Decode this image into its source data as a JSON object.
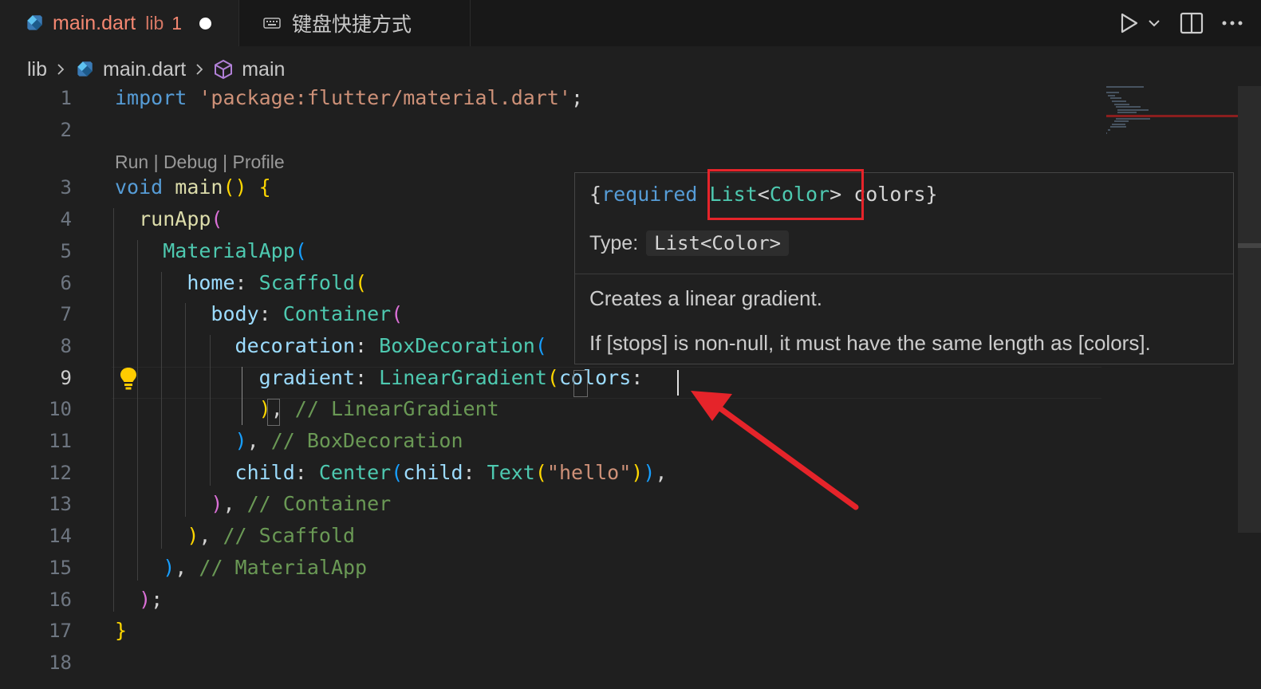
{
  "tabs": [
    {
      "name": "main.dart",
      "dir": "lib",
      "errors": "1",
      "dirty": true,
      "active": true
    },
    {
      "name": "键盘快捷方式",
      "active": false
    }
  ],
  "breadcrumb": {
    "folder": "lib",
    "file": "main.dart",
    "symbol": "main"
  },
  "editor": {
    "codelens": "Run | Debug | Profile",
    "current_line": 9,
    "lines": [
      {
        "num": "1",
        "tokens": [
          [
            "k",
            "import"
          ],
          [
            "pun",
            " "
          ],
          [
            "s",
            "'package:flutter/material.dart'"
          ],
          [
            "pun",
            ";"
          ]
        ]
      },
      {
        "num": "2",
        "tokens": []
      },
      {
        "num": "3",
        "tokens": [
          [
            "k",
            "void"
          ],
          [
            "pun",
            " "
          ],
          [
            "f",
            "main"
          ],
          [
            "b1",
            "()"
          ],
          [
            "pun",
            " "
          ],
          [
            "b1",
            "{"
          ]
        ]
      },
      {
        "num": "4",
        "tokens": [
          [
            "pun",
            "  "
          ],
          [
            "f",
            "runApp"
          ],
          [
            "b2",
            "("
          ]
        ]
      },
      {
        "num": "5",
        "tokens": [
          [
            "pun",
            "    "
          ],
          [
            "t",
            "MaterialApp"
          ],
          [
            "b3",
            "("
          ]
        ]
      },
      {
        "num": "6",
        "tokens": [
          [
            "pun",
            "      "
          ],
          [
            "p",
            "home"
          ],
          [
            "pun",
            ": "
          ],
          [
            "t",
            "Scaffold"
          ],
          [
            "b1",
            "("
          ]
        ]
      },
      {
        "num": "7",
        "tokens": [
          [
            "pun",
            "        "
          ],
          [
            "p",
            "body"
          ],
          [
            "pun",
            ": "
          ],
          [
            "t",
            "Container"
          ],
          [
            "b2",
            "("
          ]
        ]
      },
      {
        "num": "8",
        "tokens": [
          [
            "pun",
            "          "
          ],
          [
            "p",
            "decoration"
          ],
          [
            "pun",
            ": "
          ],
          [
            "t",
            "BoxDecoration"
          ],
          [
            "b3",
            "("
          ]
        ]
      },
      {
        "num": "9",
        "tokens": [
          [
            "pun",
            "            "
          ],
          [
            "p",
            "gradient"
          ],
          [
            "pun",
            ": "
          ],
          [
            "t",
            "LinearGradient"
          ],
          [
            "b1",
            "("
          ],
          [
            "p",
            "colors"
          ],
          [
            "pun",
            ":"
          ]
        ]
      },
      {
        "num": "10",
        "tokens": [
          [
            "pun",
            "            "
          ],
          [
            "b1",
            ")"
          ],
          [
            "pun",
            ", "
          ],
          [
            "c",
            "// LinearGradient"
          ]
        ]
      },
      {
        "num": "11",
        "tokens": [
          [
            "pun",
            "          "
          ],
          [
            "b3",
            ")"
          ],
          [
            "pun",
            ", "
          ],
          [
            "c",
            "// BoxDecoration"
          ]
        ]
      },
      {
        "num": "12",
        "tokens": [
          [
            "pun",
            "          "
          ],
          [
            "p",
            "child"
          ],
          [
            "pun",
            ": "
          ],
          [
            "t",
            "Center"
          ],
          [
            "b3",
            "("
          ],
          [
            "p",
            "child"
          ],
          [
            "pun",
            ": "
          ],
          [
            "t",
            "Text"
          ],
          [
            "b1",
            "("
          ],
          [
            "s",
            "\"hello\""
          ],
          [
            "b1",
            ")"
          ],
          [
            "b3",
            ")"
          ],
          [
            "pun",
            ","
          ]
        ]
      },
      {
        "num": "13",
        "tokens": [
          [
            "pun",
            "        "
          ],
          [
            "b2",
            ")"
          ],
          [
            "pun",
            ", "
          ],
          [
            "c",
            "// Container"
          ]
        ]
      },
      {
        "num": "14",
        "tokens": [
          [
            "pun",
            "      "
          ],
          [
            "b1",
            ")"
          ],
          [
            "pun",
            ", "
          ],
          [
            "c",
            "// Scaffold"
          ]
        ]
      },
      {
        "num": "15",
        "tokens": [
          [
            "pun",
            "    "
          ],
          [
            "b3",
            ")"
          ],
          [
            "pun",
            ", "
          ],
          [
            "c",
            "// MaterialApp"
          ]
        ]
      },
      {
        "num": "16",
        "tokens": [
          [
            "pun",
            "  "
          ],
          [
            "b2",
            ")"
          ],
          [
            "pun",
            ";"
          ]
        ]
      },
      {
        "num": "17",
        "tokens": [
          [
            "b1",
            "}"
          ]
        ]
      },
      {
        "num": "18",
        "tokens": []
      }
    ]
  },
  "hover": {
    "sig_open": "{",
    "sig_required": "required",
    "sig_list": "List",
    "sig_lt": "<",
    "sig_color": "Color",
    "sig_gt": ">",
    "sig_rest": " colors}",
    "type_label": "Type:",
    "type_value": "List<Color>",
    "doc_line1": "Creates a linear gradient.",
    "doc_line2": "If [stops] is non-null, it must have the same length as [colors]."
  },
  "colors": {
    "keyword": "#569cd6",
    "string": "#ce9178",
    "function": "#dcdcaa",
    "type": "#4ec9b0",
    "param": "#9cdcfe",
    "comment": "#6a9955",
    "annotation_red": "#e5242a",
    "tab_error": "#f48771"
  },
  "icons": [
    "dart-file-icon",
    "keyboard-icon",
    "run-icon",
    "chevron-down-icon",
    "split-editor-icon",
    "more-actions-icon",
    "chevron-right-icon",
    "symbol-method-icon",
    "lightbulb-icon"
  ]
}
